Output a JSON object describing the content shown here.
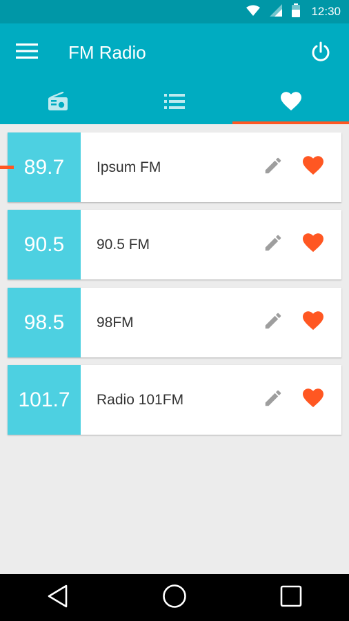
{
  "status_bar": {
    "time": "12:30"
  },
  "toolbar": {
    "title": "FM Radio"
  },
  "tabs": [
    {
      "icon": "radio-icon",
      "active": false
    },
    {
      "icon": "list-icon",
      "active": false
    },
    {
      "icon": "heart-icon",
      "active": true
    }
  ],
  "stations": [
    {
      "frequency": "89.7",
      "name": "Ipsum FM",
      "favorite": true,
      "playing": true
    },
    {
      "frequency": "90.5",
      "name": "90.5 FM",
      "favorite": true,
      "playing": false
    },
    {
      "frequency": "98.5",
      "name": "98FM",
      "favorite": true,
      "playing": false
    },
    {
      "frequency": "101.7",
      "name": "Radio 101FM",
      "favorite": true,
      "playing": false
    }
  ],
  "colors": {
    "primary": "#00acc1",
    "primary_dark": "#0097a7",
    "frequency_tile": "#4dd0e1",
    "accent": "#ff5722",
    "edit_icon": "#9e9e9e"
  }
}
